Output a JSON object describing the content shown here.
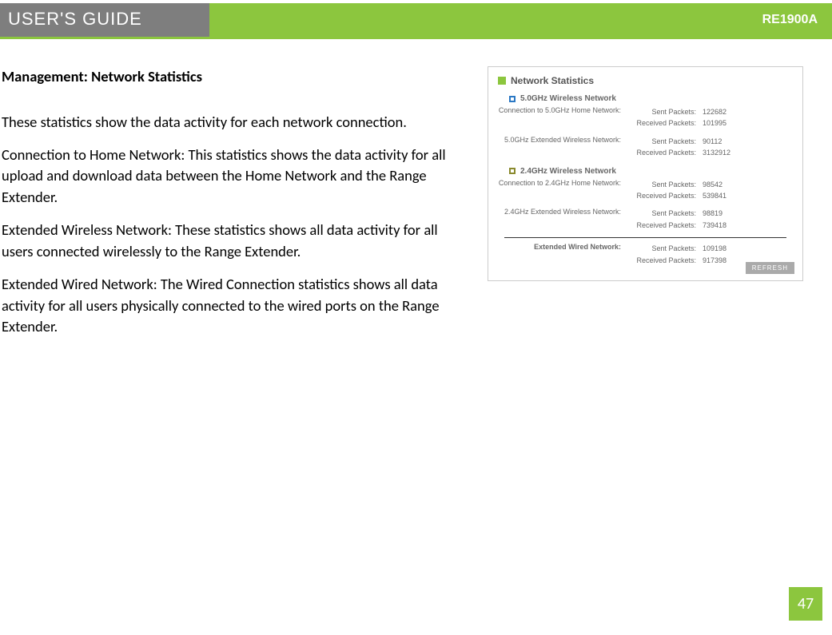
{
  "header": {
    "guide_title": "USER'S GUIDE",
    "model": "RE1900A"
  },
  "section_title": "Management: Network Statistics",
  "paragraphs": {
    "intro": "These statistics show the data activity for each network connection.",
    "p1": "Connection to Home Network: This statistics shows the data activity for all upload and download data between the Home Network and the Range Extender.",
    "p2": "Extended Wireless Network: These statistics shows all data activity for all users connected wirelessly to the Range Extender.",
    "p3": "Extended Wired Network: The Wired Connection statistics shows all data activity for all users physically connected to the wired ports on the Range Extender."
  },
  "card": {
    "title": "Network Statistics",
    "section5": "5.0GHz Wireless Network",
    "section24": "2.4GHz Wireless Network",
    "blocks": {
      "b1_label": "Connection to 5.0GHz Home Network:",
      "b2_label": "5.0GHz Extended Wireless Network:",
      "b3_label": "Connection to 2.4GHz Home Network:",
      "b4_label": "2.4GHz Extended Wireless Network:",
      "b5_label": "Extended Wired Network:"
    },
    "labels": {
      "sent": "Sent Packets:",
      "recv": "Received Packets:"
    },
    "values": {
      "b1_sent": "122682",
      "b1_recv": "101995",
      "b2_sent": "90112",
      "b2_recv": "3132912",
      "b3_sent": "98542",
      "b3_recv": "539841",
      "b4_sent": "98819",
      "b4_recv": "739418",
      "b5_sent": "109198",
      "b5_recv": "917398"
    },
    "refresh": "REFRESH"
  },
  "page_number": "47"
}
